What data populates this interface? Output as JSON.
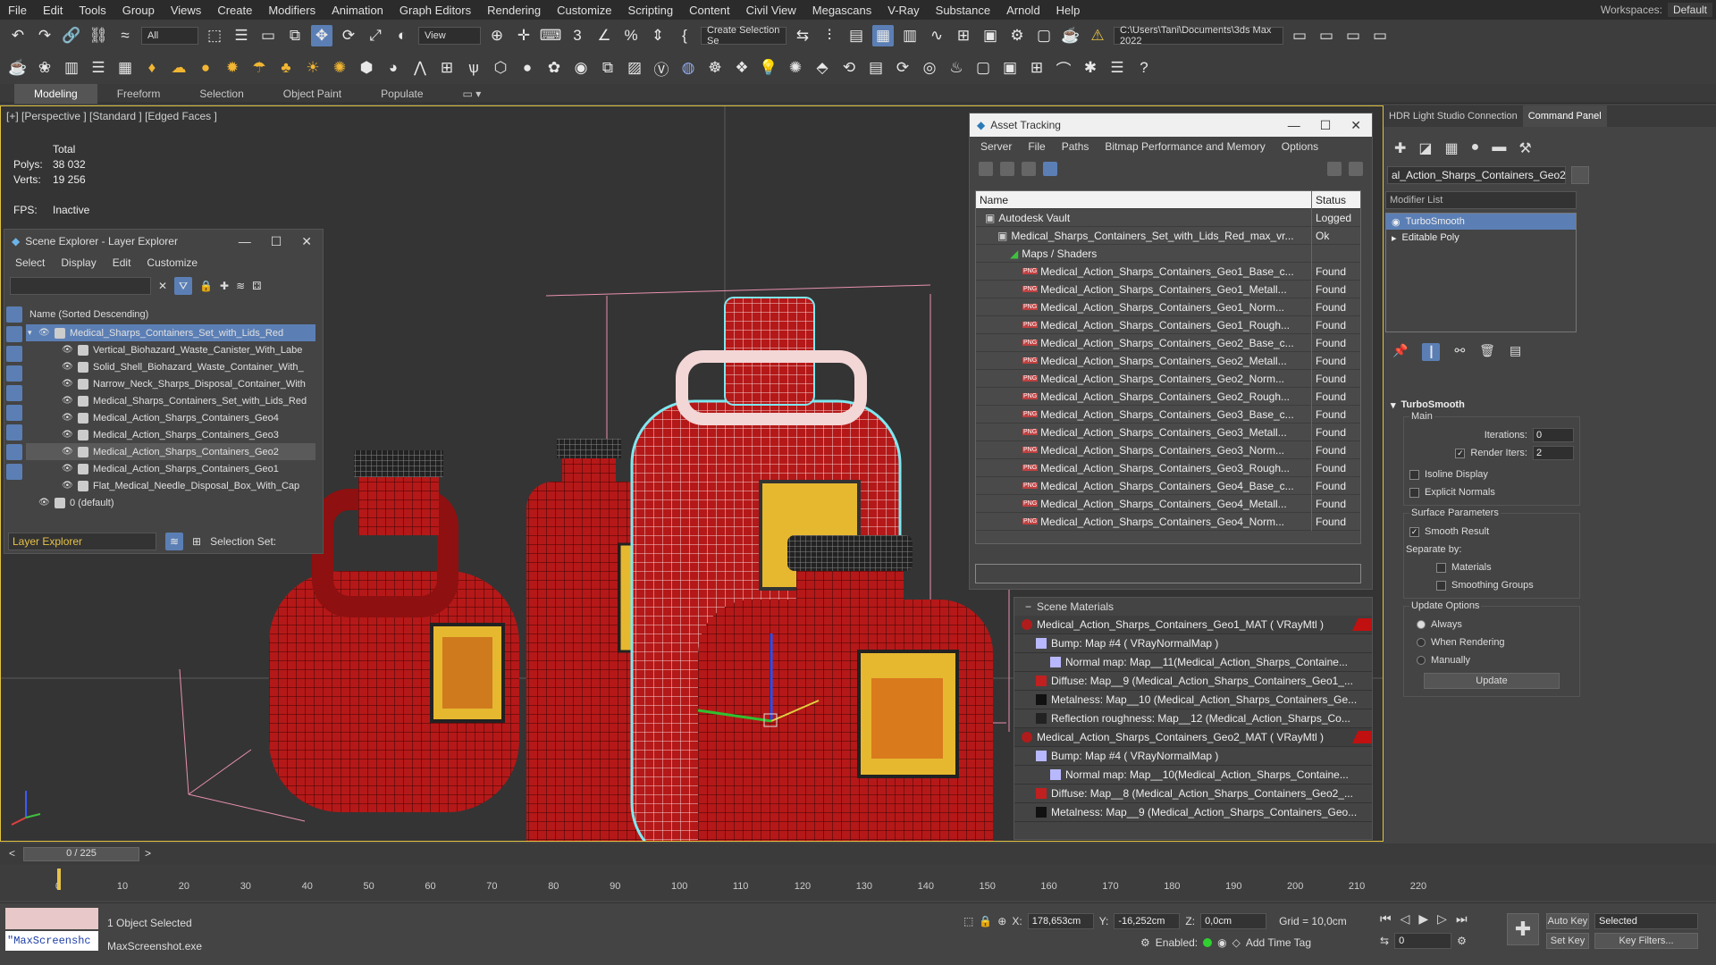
{
  "menu": [
    "File",
    "Edit",
    "Tools",
    "Group",
    "Views",
    "Create",
    "Modifiers",
    "Animation",
    "Graph Editors",
    "Rendering",
    "Customize",
    "Scripting",
    "Content",
    "Civil View",
    "Megascans",
    "V-Ray",
    "Substance",
    "Arnold",
    "Help"
  ],
  "workspaces": {
    "label": "Workspaces:",
    "value": "Default"
  },
  "toolbar": {
    "selection_filter": "All",
    "ref_coord": "View",
    "selection_set": "Create Selection Se",
    "project_path": "C:\\Users\\Tani\\Documents\\3ds Max 2022"
  },
  "ribbon_tabs": [
    "Modeling",
    "Freeform",
    "Selection",
    "Object Paint",
    "Populate"
  ],
  "viewport": {
    "label": "[+] [Perspective ] [Standard ] [Edged Faces ]",
    "stats_total": "Total",
    "polys_label": "Polys:",
    "polys": "38 032",
    "verts_label": "Verts:",
    "verts": "19 256",
    "fps_label": "FPS:",
    "fps": "Inactive"
  },
  "scene_explorer": {
    "title": "Scene Explorer - Layer Explorer",
    "menu": [
      "Select",
      "Display",
      "Edit",
      "Customize"
    ],
    "column": "Name (Sorted Descending)",
    "rows": [
      {
        "name": "Medical_Sharps_Containers_Set_with_Lids_Red",
        "level": 0,
        "state": "sel"
      },
      {
        "name": "Vertical_Biohazard_Waste_Canister_With_Labe",
        "level": 1,
        "state": ""
      },
      {
        "name": "Solid_Shell_Biohazard_Waste_Container_With_",
        "level": 1,
        "state": ""
      },
      {
        "name": "Narrow_Neck_Sharps_Disposal_Container_With",
        "level": 1,
        "state": ""
      },
      {
        "name": "Medical_Sharps_Containers_Set_with_Lids_Red",
        "level": 1,
        "state": ""
      },
      {
        "name": "Medical_Action_Sharps_Containers_Geo4",
        "level": 1,
        "state": ""
      },
      {
        "name": "Medical_Action_Sharps_Containers_Geo3",
        "level": 1,
        "state": ""
      },
      {
        "name": "Medical_Action_Sharps_Containers_Geo2",
        "level": 1,
        "state": "hl"
      },
      {
        "name": "Medical_Action_Sharps_Containers_Geo1",
        "level": 1,
        "state": ""
      },
      {
        "name": "Flat_Medical_Needle_Disposal_Box_With_Cap",
        "level": 1,
        "state": ""
      },
      {
        "name": "0 (default)",
        "level": 0,
        "state": ""
      }
    ],
    "footer_dropdown": "Layer Explorer",
    "footer_label": "Selection Set:"
  },
  "asset_tracking": {
    "title": "Asset Tracking",
    "menu": [
      "Server",
      "File",
      "Paths",
      "Bitmap Performance and Memory",
      "Options"
    ],
    "col_name": "Name",
    "col_status": "Status",
    "rows": [
      {
        "name": "Autodesk Vault",
        "status": "Logged",
        "indent": 1,
        "png": false
      },
      {
        "name": "Medical_Sharps_Containers_Set_with_Lids_Red_max_vr...",
        "status": "Ok",
        "indent": 2,
        "png": false
      },
      {
        "name": "Maps / Shaders",
        "status": "",
        "indent": 3,
        "png": false
      },
      {
        "name": "Medical_Action_Sharps_Containers_Geo1_Base_c...",
        "status": "Found",
        "indent": 4,
        "png": true
      },
      {
        "name": "Medical_Action_Sharps_Containers_Geo1_Metall...",
        "status": "Found",
        "indent": 4,
        "png": true
      },
      {
        "name": "Medical_Action_Sharps_Containers_Geo1_Norm...",
        "status": "Found",
        "indent": 4,
        "png": true
      },
      {
        "name": "Medical_Action_Sharps_Containers_Geo1_Rough...",
        "status": "Found",
        "indent": 4,
        "png": true
      },
      {
        "name": "Medical_Action_Sharps_Containers_Geo2_Base_c...",
        "status": "Found",
        "indent": 4,
        "png": true
      },
      {
        "name": "Medical_Action_Sharps_Containers_Geo2_Metall...",
        "status": "Found",
        "indent": 4,
        "png": true
      },
      {
        "name": "Medical_Action_Sharps_Containers_Geo2_Norm...",
        "status": "Found",
        "indent": 4,
        "png": true
      },
      {
        "name": "Medical_Action_Sharps_Containers_Geo2_Rough...",
        "status": "Found",
        "indent": 4,
        "png": true
      },
      {
        "name": "Medical_Action_Sharps_Containers_Geo3_Base_c...",
        "status": "Found",
        "indent": 4,
        "png": true
      },
      {
        "name": "Medical_Action_Sharps_Containers_Geo3_Metall...",
        "status": "Found",
        "indent": 4,
        "png": true
      },
      {
        "name": "Medical_Action_Sharps_Containers_Geo3_Norm...",
        "status": "Found",
        "indent": 4,
        "png": true
      },
      {
        "name": "Medical_Action_Sharps_Containers_Geo3_Rough...",
        "status": "Found",
        "indent": 4,
        "png": true
      },
      {
        "name": "Medical_Action_Sharps_Containers_Geo4_Base_c...",
        "status": "Found",
        "indent": 4,
        "png": true
      },
      {
        "name": "Medical_Action_Sharps_Containers_Geo4_Metall...",
        "status": "Found",
        "indent": 4,
        "png": true
      },
      {
        "name": "Medical_Action_Sharps_Containers_Geo4_Norm...",
        "status": "Found",
        "indent": 4,
        "png": true
      }
    ]
  },
  "scene_materials": {
    "title": "Scene Materials",
    "rows": [
      {
        "text": "Medical_Action_Sharps_Containers_Geo1_MAT ( VRayMtl )",
        "kind": "mat",
        "swatch": "#b01c1c"
      },
      {
        "text": "Bump: Map #4  ( VRayNormalMap )",
        "kind": "map1",
        "swatch": "#b8b8ff"
      },
      {
        "text": "Normal map: Map__11(Medical_Action_Sharps_Containe...",
        "kind": "map2",
        "swatch": "#b8b8ff"
      },
      {
        "text": "Diffuse: Map__9 (Medical_Action_Sharps_Containers_Geo1_...",
        "kind": "map1",
        "swatch": "#c02020"
      },
      {
        "text": "Metalness: Map__10 (Medical_Action_Sharps_Containers_Ge...",
        "kind": "map1",
        "swatch": "#111111"
      },
      {
        "text": "Reflection roughness: Map__12 (Medical_Action_Sharps_Co...",
        "kind": "map1",
        "swatch": "#222222"
      },
      {
        "text": "Medical_Action_Sharps_Containers_Geo2_MAT ( VRayMtl )",
        "kind": "mat",
        "swatch": "#b01c1c"
      },
      {
        "text": "Bump: Map #4  ( VRayNormalMap )",
        "kind": "map1",
        "swatch": "#b8b8ff"
      },
      {
        "text": "Normal map: Map__10(Medical_Action_Sharps_Containe...",
        "kind": "map2",
        "swatch": "#b8b8ff"
      },
      {
        "text": "Diffuse: Map__8 (Medical_Action_Sharps_Containers_Geo2_...",
        "kind": "map1",
        "swatch": "#c02020"
      },
      {
        "text": "Metalness: Map__9 (Medical_Action_Sharps_Containers_Geo...",
        "kind": "map1",
        "swatch": "#111111"
      }
    ]
  },
  "command_panel": {
    "tab1": "HDR Light Studio Connection",
    "tab2": "Command Panel",
    "object_name": "al_Action_Sharps_Containers_Geo2",
    "modifier_list": "Modifier List",
    "stack": [
      "TurboSmooth",
      "Editable Poly"
    ],
    "turbosmooth": {
      "title": "TurboSmooth",
      "main": "Main",
      "iterations_label": "Iterations:",
      "iterations": "0",
      "render_iters_label": "Render Iters:",
      "render_iters": "2",
      "isoline": "Isoline Display",
      "explicit": "Explicit Normals",
      "surface": "Surface Parameters",
      "smooth_result": "Smooth Result",
      "separate_by": "Separate by:",
      "materials": "Materials",
      "smoothing_groups": "Smoothing Groups",
      "update_options": "Update Options",
      "always": "Always",
      "when_rendering": "When Rendering",
      "manually": "Manually",
      "update_btn": "Update"
    }
  },
  "timeline": {
    "frame": "0 / 225",
    "ticks": [
      "0",
      "10",
      "20",
      "30",
      "40",
      "50",
      "60",
      "70",
      "80",
      "90",
      "100",
      "110",
      "120",
      "130",
      "140",
      "150",
      "160",
      "170",
      "180",
      "190",
      "200",
      "210",
      "220"
    ]
  },
  "status": {
    "maxscript": "\"MaxScreenshc",
    "selected": "1 Object Selected",
    "exe": "MaxScreenshot.exe",
    "x_label": "X:",
    "x": "178,653cm",
    "y_label": "Y:",
    "y": "-16,252cm",
    "z_label": "Z:",
    "z": "0,0cm",
    "grid": "Grid = 10,0cm",
    "enabled": "Enabled:",
    "add_time_tag": "Add Time Tag",
    "auto_key": "Auto Key",
    "set_key": "Set Key",
    "selected_dd": "Selected",
    "key_filters": "Key Filters...",
    "frame_spinner": "0"
  },
  "colors": {
    "accent": "#5b7fb5",
    "red_mesh": "#b01c1c",
    "wire_sel": "#7fe8f0"
  }
}
